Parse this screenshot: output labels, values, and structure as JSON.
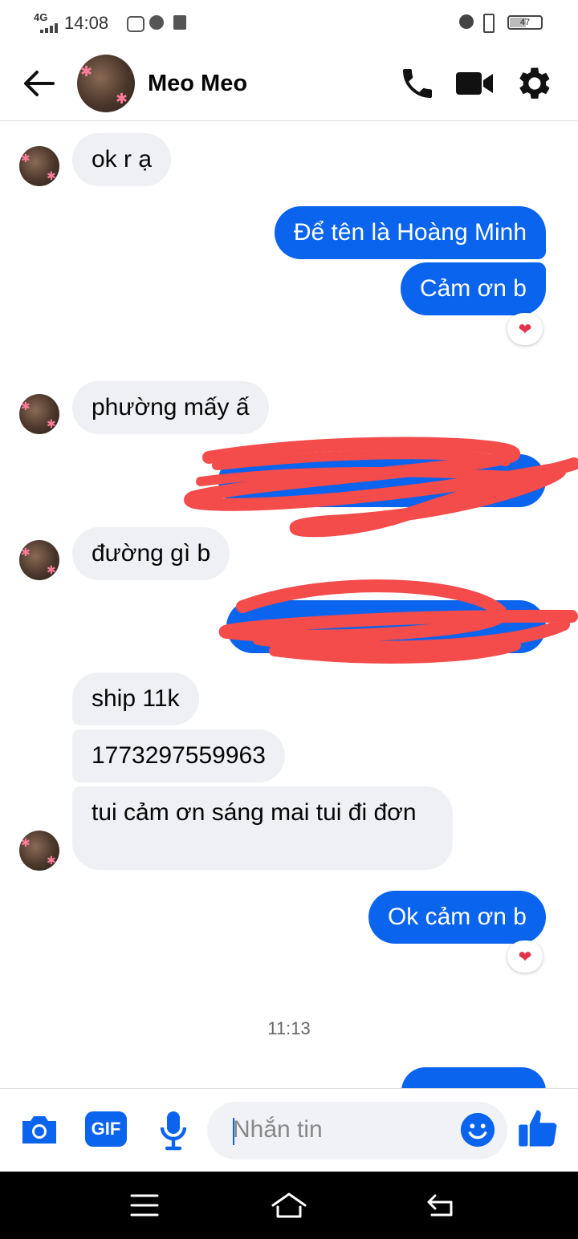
{
  "status_bar": {
    "network": "4G",
    "time": "14:08",
    "battery": "47"
  },
  "header": {
    "contact_name": "Meo Meo",
    "icons": [
      "back-arrow-icon",
      "phone-icon",
      "video-camera-icon",
      "gear-icon"
    ]
  },
  "messages": [
    {
      "side": "in",
      "text": "ok r ạ"
    },
    {
      "side": "out",
      "text": "Để tên là Hoàng Minh"
    },
    {
      "side": "out",
      "text": "Cảm ơn b"
    },
    {
      "side": "in",
      "text": "phường mấy ấ"
    },
    {
      "side": "in",
      "text": "đường gì b"
    },
    {
      "side": "in",
      "text": "ship 11k"
    },
    {
      "side": "in",
      "text": "1773297559963"
    },
    {
      "side": "in",
      "text": "tui cảm ơn sáng mai tui đi đơn"
    },
    {
      "side": "out",
      "text": "Ok cảm ơn b"
    }
  ],
  "reaction_icon": "heart-reaction-icon",
  "timestamp": "11:13",
  "composer": {
    "placeholder": "Nhắn tin",
    "gif_label": "GIF",
    "icons": [
      "camera-icon",
      "gif-icon",
      "microphone-icon",
      "emoji-icon",
      "thumbs-up-icon"
    ]
  },
  "colors": {
    "accent": "#0a64ed",
    "incoming_bubble": "#eff0f3",
    "scribble": "#f44b4b"
  }
}
